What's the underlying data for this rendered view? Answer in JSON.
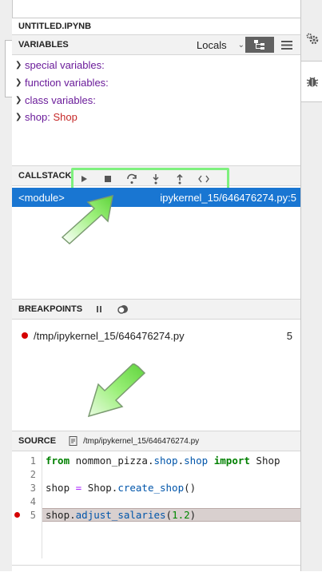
{
  "notebook": {
    "title": "UNTITLED.IPYNB"
  },
  "variables": {
    "header": "VARIABLES",
    "scope": "Locals",
    "items": [
      {
        "name": "special variables",
        "value": ""
      },
      {
        "name": "function variables",
        "value": ""
      },
      {
        "name": "class variables",
        "value": ""
      },
      {
        "name": "shop",
        "value": "Shop"
      }
    ]
  },
  "callstack": {
    "header": "CALLSTACK",
    "controls": [
      "continue",
      "terminate",
      "step-over",
      "step-in",
      "step-out",
      "evaluate"
    ],
    "frames": [
      {
        "name": "<module>",
        "location": "ipykernel_15/646476274.py:5"
      }
    ]
  },
  "breakpoints": {
    "header": "BREAKPOINTS",
    "items": [
      {
        "file": "/tmp/ipykernel_15/646476274.py",
        "line": "5"
      }
    ]
  },
  "source": {
    "header": "SOURCE",
    "path": "/tmp/ipykernel_15/646476274.py",
    "lines": [
      {
        "num": "1",
        "text": "from nommon_pizza.shop.shop import Shop"
      },
      {
        "num": "2",
        "text": ""
      },
      {
        "num": "3",
        "text": "shop = Shop.create_shop()"
      },
      {
        "num": "4",
        "text": ""
      },
      {
        "num": "5",
        "text": "shop.adjust_salaries(1.2)"
      }
    ]
  },
  "colors": {
    "accent": "#1976d2",
    "highlight": "#7ef07e",
    "breakpoint": "#d50000"
  }
}
